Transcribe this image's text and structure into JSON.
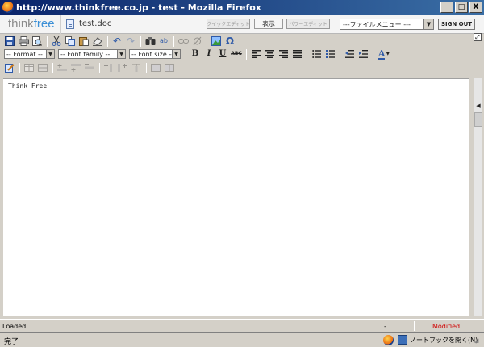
{
  "window": {
    "title": "http://www.thinkfree.co.jp - test - Mozilla Firefox",
    "buttons": {
      "minimize": "_",
      "maximize": "□",
      "close": "X"
    }
  },
  "header": {
    "logo_think": "think",
    "logo_free": "free",
    "doc_name": "test.doc",
    "quick_edit": "クイックエディット",
    "view": "表示",
    "power_edit": "パワーエディット",
    "file_menu": "---ファイルメニュー ---",
    "sign_out": "SIGN OUT"
  },
  "toolbar": {
    "format": "-- Format --",
    "font_family": "-- Font family --",
    "font_size": "-- Font size --",
    "bold": "B",
    "italic": "I",
    "underline": "U",
    "strikethrough": "ABC",
    "font_color": "A",
    "special_char": "Ω"
  },
  "editor": {
    "content": "Think Free"
  },
  "status": {
    "loaded": "Loaded.",
    "dash": "-",
    "modified": "Modified",
    "done": "完了",
    "notebook": "ノートブックを開く(N)"
  },
  "colors": {
    "titlebar": "#0a246a",
    "logo_free": "#3b8fd6",
    "modified": "#d00000"
  }
}
